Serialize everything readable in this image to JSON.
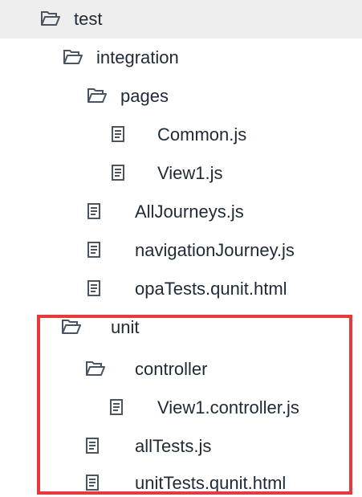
{
  "tree": {
    "items": [
      {
        "label": "test",
        "type": "folder",
        "icon": "folder-open-icon",
        "selected": true
      },
      {
        "label": "integration",
        "type": "folder",
        "icon": "folder-open-icon"
      },
      {
        "label": "pages",
        "type": "folder",
        "icon": "folder-open-icon"
      },
      {
        "label": "Common.js",
        "type": "file",
        "icon": "document-icon"
      },
      {
        "label": "View1.js",
        "type": "file",
        "icon": "document-icon"
      },
      {
        "label": "AllJourneys.js",
        "type": "file",
        "icon": "document-icon"
      },
      {
        "label": "navigationJourney.js",
        "type": "file",
        "icon": "document-icon"
      },
      {
        "label": "opaTests.qunit.html",
        "type": "file",
        "icon": "document-icon"
      },
      {
        "label": "unit",
        "type": "folder",
        "icon": "folder-open-icon"
      },
      {
        "label": "controller",
        "type": "folder",
        "icon": "folder-open-icon"
      },
      {
        "label": "View1.controller.js",
        "type": "file",
        "icon": "document-icon"
      },
      {
        "label": "allTests.js",
        "type": "file",
        "icon": "document-icon"
      },
      {
        "label": "unitTests.qunit.html",
        "type": "file",
        "icon": "document-icon"
      }
    ]
  },
  "colors": {
    "text": "#1f2a36",
    "icon": "#4a5560",
    "selected_row": "#eeeeee",
    "highlight": "#e8393d"
  }
}
